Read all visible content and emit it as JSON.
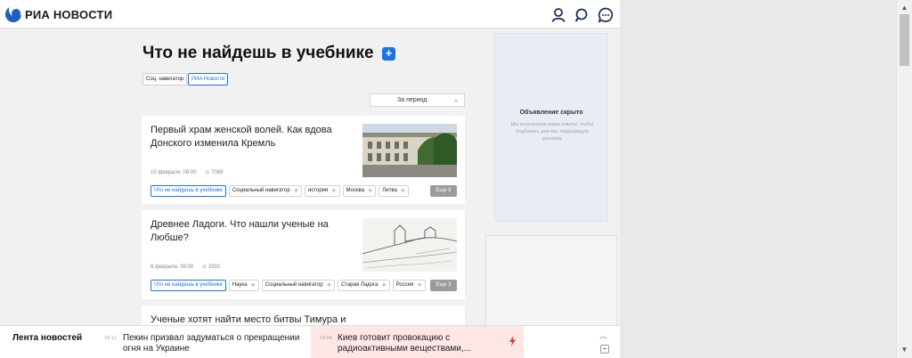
{
  "header": {
    "logo_text": "РИА НОВОСТИ",
    "icons": [
      "user-icon",
      "search-icon",
      "chat-icon"
    ]
  },
  "page": {
    "title": "Что не найдешь в учебнике",
    "plus_symbol": "+",
    "sources": [
      "Соц. навигатор",
      "РИА Новости"
    ],
    "period_label": "За период"
  },
  "articles": [
    {
      "title": "Первый храм женской волей. Как вдова Донского изменила Кремль",
      "date": "15 февраля, 09:00",
      "views": "7069",
      "tags": [
        "Что не найдешь в учебнике",
        "Социальный навигатор",
        "история",
        "Москва",
        "Литва"
      ],
      "more": "Еще 8"
    },
    {
      "title": "Древнее Ладоги. Что нашли ученые на Любше?",
      "date": "6 февраля, 09:00",
      "views": "2392",
      "tags": [
        "Что не найдешь в учебнике",
        "Наука",
        "Социальный навигатор",
        "Старая Ладога",
        "Россия"
      ],
      "more": "Еще 3"
    },
    {
      "title": "Ученые хотят найти место битвы Тимура и"
    }
  ],
  "ad": {
    "title": "Объявление скрыто",
    "text": "Мы используем ваши ответы, чтобы подбирать для вас подходящую рекламу"
  },
  "newsbar": {
    "label": "Лента новостей",
    "items": [
      {
        "time": "18:12",
        "text": "Пекин призвал задуматься о прекращении огня на Украине"
      },
      {
        "time": "18:04",
        "text": "Киев готовит провокацию с радиоактивными веществами,..."
      }
    ]
  },
  "colors": {
    "accent": "#1a73e8",
    "brand": "#1f5fbf",
    "hot_bg": "#fde6e6",
    "bolt": "#e53935"
  }
}
